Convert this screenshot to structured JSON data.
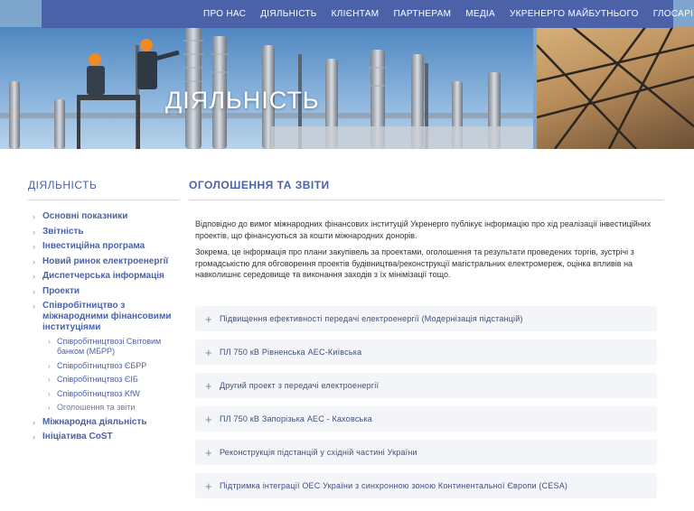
{
  "nav": {
    "items": [
      "ПРО НАС",
      "ДІЯЛЬНІСТЬ",
      "КЛІЄНТАМ",
      "ПАРТНЕРАМ",
      "МЕДІА",
      "УКРЕНЕРГО МАЙБУТНЬОГО",
      "ГЛОСАРІЙ"
    ]
  },
  "hero": {
    "title": "ДІЯЛЬНІСТЬ"
  },
  "sidebar": {
    "title": "ДІЯЛЬНІСТЬ",
    "items": [
      {
        "label": "Основні показники"
      },
      {
        "label": "Звітність"
      },
      {
        "label": "Інвестиційна програма"
      },
      {
        "label": "Новий ринок електроенергії"
      },
      {
        "label": "Диспетчерська інформація"
      },
      {
        "label": "Проекти"
      },
      {
        "label": "Співробітництво з міжнародними фінансовими інституціями"
      },
      {
        "label": "Міжнародна діяльність"
      },
      {
        "label": "Ініціатива CoST"
      }
    ],
    "sub_items": [
      {
        "label": "Співробітництвозі Світовим банком (МБРР)"
      },
      {
        "label": "Співробітництвоз ЄБРР"
      },
      {
        "label": "Співробітництвоз ЄІБ"
      },
      {
        "label": "Співробітництвоз KfW"
      },
      {
        "label": "Оголошення та звіти"
      }
    ]
  },
  "main": {
    "title": "ОГОЛОШЕННЯ ТА ЗВІТИ",
    "paragraphs": [
      "Відповідно до вимог міжнародних фінансових інституцій Укренерго публікує інформацію про хід реалізації інвестиційних проектів, що фінансуються за кошти міжнародних донорів.",
      "Зокрема, це інформація про плани закупівель за проектами, оголошення та результати проведених торгів, зустрічі з громадськістю для обговорення проектів будівництва/реконструкції магістральних електромереж, оцінка впливів на навколишнє середовище та виконання заходів з їх мінімізації тощо."
    ],
    "accordion": [
      {
        "label": "Підвищення ефективності передачі електроенергії (Модернізація підстанцій)"
      },
      {
        "label": "ПЛ 750 кВ Рівненська АЕС-Київська"
      },
      {
        "label": "Другий проект з передачі електроенергії"
      },
      {
        "label": "ПЛ 750 кВ Запорізька АЕС - Каховська"
      },
      {
        "label": "Реконструкція підстанцій у східній частині України"
      },
      {
        "label": "Підтримка інтеграції ОЕС України з синхронною зоною Континентальної Європи (CESA)"
      }
    ]
  }
}
